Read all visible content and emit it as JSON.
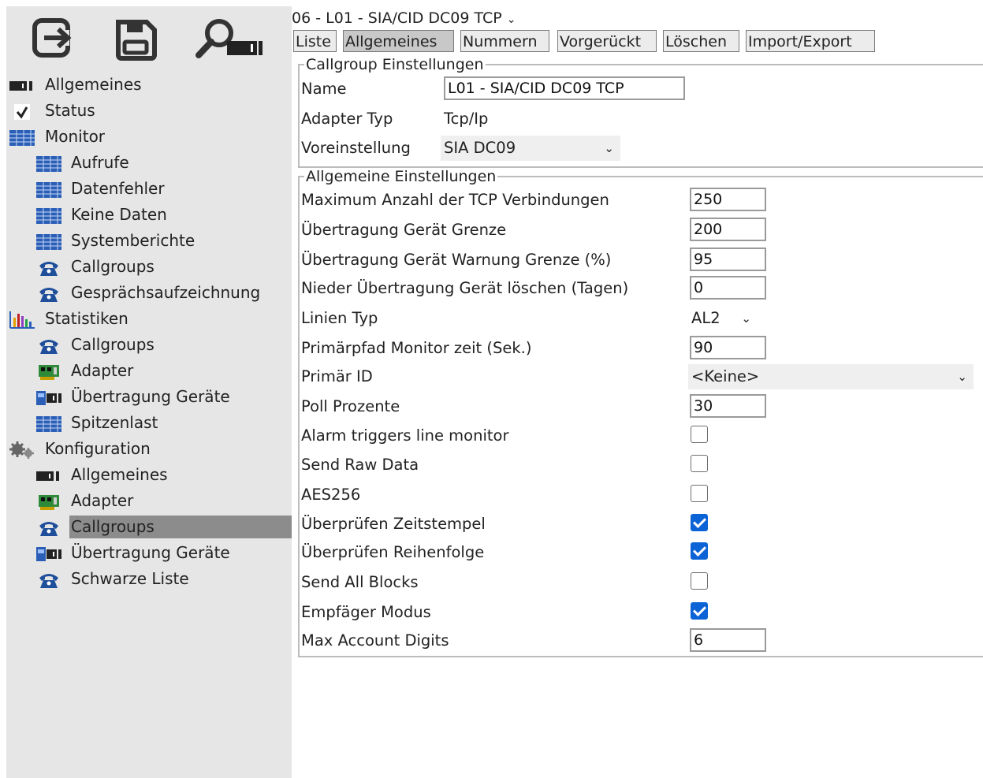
{
  "toolbar": {
    "logout_icon": "logout-icon",
    "save_icon": "save-icon",
    "search_icon": "search-device-icon"
  },
  "sidebar": {
    "items": [
      {
        "label": "Allgemeines",
        "icon": "device-icon"
      },
      {
        "label": "Status",
        "icon": "checkmark-icon"
      },
      {
        "label": "Monitor",
        "icon": "monitor-grid-icon"
      },
      {
        "label": "Aufrufe",
        "icon": "monitor-grid-icon"
      },
      {
        "label": "Datenfehler",
        "icon": "monitor-grid-icon"
      },
      {
        "label": "Keine Daten",
        "icon": "monitor-grid-icon"
      },
      {
        "label": "Systemberichte",
        "icon": "monitor-grid-icon"
      },
      {
        "label": "Callgroups",
        "icon": "telephone-icon"
      },
      {
        "label": "Gesprächsaufzeichnung",
        "icon": "telephone-icon"
      },
      {
        "label": "Statistiken",
        "icon": "bar-chart-icon"
      },
      {
        "label": "Callgroups",
        "icon": "telephone-icon"
      },
      {
        "label": "Adapter",
        "icon": "adapter-card-icon"
      },
      {
        "label": "Übertragung Geräte",
        "icon": "transmitter-icon"
      },
      {
        "label": "Spitzenlast",
        "icon": "monitor-grid-icon"
      },
      {
        "label": "Konfiguration",
        "icon": "gears-icon"
      },
      {
        "label": "Allgemeines",
        "icon": "device-icon"
      },
      {
        "label": "Adapter",
        "icon": "adapter-card-icon"
      },
      {
        "label": "Callgroups",
        "icon": "telephone-icon",
        "selected": true
      },
      {
        "label": "Übertragung Geräte",
        "icon": "transmitter-icon"
      },
      {
        "label": "Schwarze Liste",
        "icon": "telephone-icon"
      }
    ]
  },
  "header": {
    "title": "06 - L01 - SIA/CID DC09 TCP",
    "chevron": "⌄"
  },
  "tabs": [
    {
      "label": "Liste"
    },
    {
      "label": "Allgemeines",
      "active": true
    },
    {
      "label": "Nummern"
    },
    {
      "label": "Vorgerückt"
    },
    {
      "label": "Löschen"
    },
    {
      "label": "Import/Export"
    }
  ],
  "callgroup_settings": {
    "legend": "Callgroup Einstellungen",
    "name_label": "Name",
    "name_value": "L01 - SIA/CID DC09 TCP",
    "adapter_type_label": "Adapter Typ",
    "adapter_type_value": "Tcp/Ip",
    "preset_label": "Voreinstellung",
    "preset_value": "SIA DC09"
  },
  "general_settings": {
    "legend": "Allgemeine Einstellungen",
    "max_tcp_label": "Maximum Anzahl der TCP Verbindungen",
    "max_tcp_value": "250",
    "device_limit_label": "Übertragung Gerät Grenze",
    "device_limit_value": "200",
    "device_warning_label": "Übertragung Gerät Warnung Grenze (%)",
    "device_warning_value": "95",
    "delete_low_label": "Nieder Übertragung Gerät löschen (Tagen)",
    "delete_low_value": "0",
    "line_type_label": "Linien Typ",
    "line_type_value": "AL2",
    "primary_path_label": "Primärpfad Monitor zeit (Sek.)",
    "primary_path_value": "90",
    "primary_id_label": "Primär ID",
    "primary_id_value": "<Keine>",
    "poll_percent_label": "Poll Prozente",
    "poll_percent_value": "30",
    "alarm_triggers_label": "Alarm triggers line monitor",
    "alarm_triggers_checked": false,
    "send_raw_label": "Send Raw Data",
    "send_raw_checked": false,
    "aes256_label": "AES256",
    "aes256_checked": false,
    "check_timestamp_label": "Überprüfen Zeitstempel",
    "check_timestamp_checked": true,
    "check_sequence_label": "Überprüfen Reihenfolge",
    "check_sequence_checked": true,
    "send_all_blocks_label": "Send All Blocks",
    "send_all_blocks_checked": false,
    "receiver_mode_label": "Empfäger Modus",
    "receiver_mode_checked": true,
    "max_account_digits_label": "Max Account Digits",
    "max_account_digits_value": "6"
  },
  "colors": {
    "sidebar_bg": "#e6e6e6",
    "selected_bg": "#8c8c8c",
    "checkbox_on": "#0b63d6",
    "icon_blue": "#2b5fb7"
  }
}
